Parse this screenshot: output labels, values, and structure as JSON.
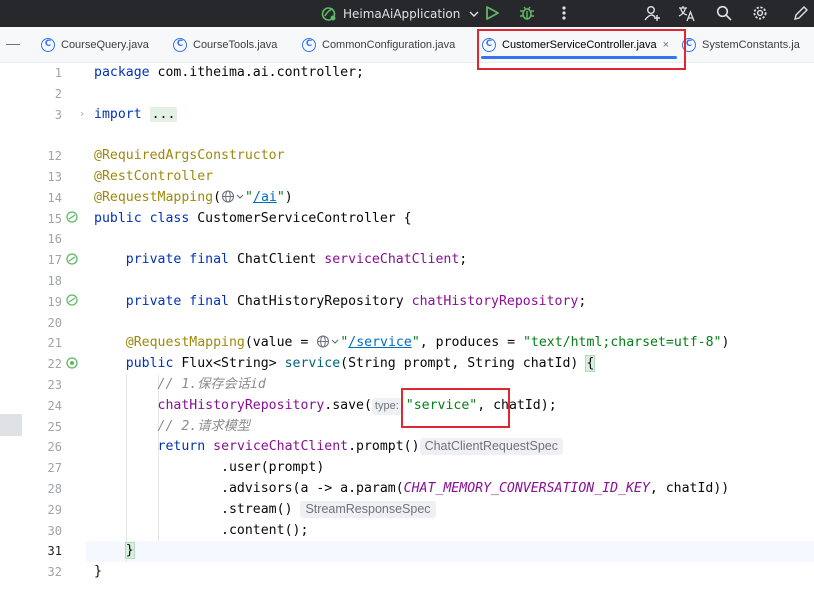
{
  "toolbar": {
    "run_config_name": "HeimaAiApplication",
    "icons": [
      "spring-icon",
      "chevron-down-icon",
      "run-icon",
      "debug-icon",
      "more-icon",
      "add-user-icon",
      "translate-icon",
      "search-icon",
      "settings-icon",
      "edit-icon"
    ],
    "colors": {
      "background": "#27282c",
      "run": "#5fb865",
      "debug": "#5fb865"
    }
  },
  "tabs": [
    {
      "label": "CourseQuery.java",
      "active": false
    },
    {
      "label": "CourseTools.java",
      "active": false
    },
    {
      "label": "CommonConfiguration.java",
      "active": false
    },
    {
      "label": "CustomerServiceController.java",
      "active": true,
      "close": "×"
    },
    {
      "label": "SystemConstants.ja",
      "active": false
    }
  ],
  "editor": {
    "line_numbers": [
      "1",
      "2",
      "3",
      "12",
      "13",
      "14",
      "15",
      "16",
      "17",
      "18",
      "19",
      "20",
      "21",
      "22",
      "23",
      "24",
      "25",
      "26",
      "27",
      "28",
      "29",
      "30",
      "31",
      "32"
    ],
    "current_line": "31",
    "code": {
      "package_kw": "package",
      "package_name": "com.itheima.ai.controller;",
      "import_kw": "import",
      "import_fold": "...",
      "ann_required": "@RequiredArgsConstructor",
      "ann_rest": "@RestController",
      "ann_mapping": "@RequestMapping",
      "ai_path": "/ai",
      "class_mods": "public class",
      "class_name": "CustomerServiceController {",
      "private_final": "private final",
      "chatclient_type": "ChatClient",
      "service_chat_client": "serviceChatClient",
      "history_repo_type": "ChatHistoryRepository",
      "chat_history_repository": "chatHistoryRepository",
      "value_attr": "(value = ",
      "service_path": "/service",
      "produces_attr": ", produces = ",
      "produces_value": "\"text/html;charset=utf-8\"",
      "public_kw": "public",
      "return_type": "Flux<String>",
      "method_name": "service",
      "params": "(String prompt, String chatId) ",
      "comment1": "// 1.保存会话id",
      "save_call": ".save(",
      "type_hint": "type:",
      "service_string": "\"service\"",
      "save_args_rest": ", chatId);",
      "comment2": "// 2.请求模型",
      "return_kw": "return",
      "prompt_call": ".prompt()",
      "prompt_hint": "ChatClientRequestSpec",
      "user_call": ".user(prompt)",
      "advisors_call": ".advisors(a -> a.param(",
      "memory_const": "CHAT_MEMORY_CONVERSATION_ID_KEY",
      "advisors_rest": ", chatId))",
      "stream_call": ".stream()",
      "stream_hint": "StreamResponseSpec",
      "content_call": ".content();",
      "close_brace": "}"
    },
    "colors": {
      "keyword": "#0033b3",
      "annotation": "#9e880d",
      "string": "#067d17",
      "field": "#871094",
      "comment": "#8c8c8c",
      "highlight_box": "#e0262e"
    }
  }
}
